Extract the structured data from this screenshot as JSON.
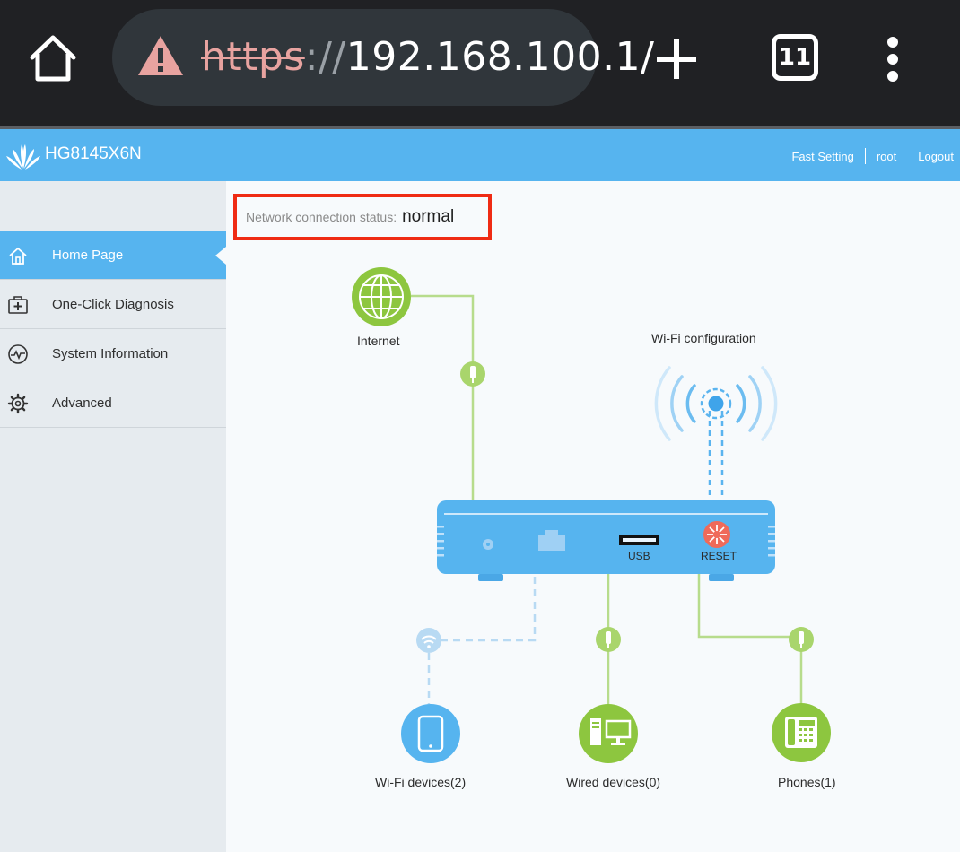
{
  "browser": {
    "url_protocol": "https",
    "url_separator": "://",
    "url_host": "192.168.100.1/",
    "tab_count": "11"
  },
  "header": {
    "model": "HG8145X6N",
    "links": {
      "fast_setting": "Fast Setting",
      "user": "root",
      "logout": "Logout"
    }
  },
  "sidebar": {
    "items": [
      {
        "label": "Home Page",
        "icon": "home-icon",
        "active": true
      },
      {
        "label": "One-Click Diagnosis",
        "icon": "medical-kit-icon",
        "active": false
      },
      {
        "label": "System Information",
        "icon": "pulse-icon",
        "active": false
      },
      {
        "label": "Advanced",
        "icon": "gear-icon",
        "active": false
      }
    ]
  },
  "status": {
    "label": "Network connection status:",
    "value": "normal"
  },
  "diagram": {
    "internet_label": "Internet",
    "wifi_config_label": "Wi-Fi configuration",
    "usb_label": "USB",
    "reset_label": "RESET",
    "wifi_devices_label": "Wi-Fi devices(2)",
    "wired_devices_label": "Wired devices(0)",
    "phones_label": "Phones(1)"
  },
  "colors": {
    "accent_blue": "#56b4ef",
    "green": "#8dc63f",
    "highlight_red": "#ef2b14",
    "browser_dark": "#202124"
  }
}
